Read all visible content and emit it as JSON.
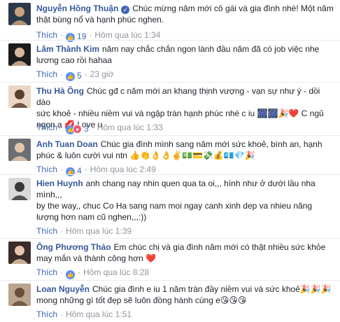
{
  "comments": [
    {
      "author": "Nguyễn Hồng Thuận",
      "verified": true,
      "text_lines": [
        "Chúc mừng năm mới cô gái và gia đình nhé! Một năm",
        "thật bùng nổ và hạnh phúc nghen."
      ],
      "like_label": "Thích",
      "reactions": [
        "like"
      ],
      "reaction_count": "19",
      "time": "Hôm qua lúc 1:34",
      "avatar_colors": [
        "#2b3a4a",
        "#c9a27e"
      ]
    },
    {
      "author": "Lâm Thành Kim",
      "verified": false,
      "text_lines": [
        "năm nay chắc chắn ngon lành đầu năm đã có job việc nhẹ",
        "lương cao rồi hahaa"
      ],
      "like_label": "Thích",
      "reactions": [
        "like"
      ],
      "reaction_count": "5",
      "time": "23 giờ",
      "avatar_colors": [
        "#1c1c1c",
        "#d8b79a"
      ]
    },
    {
      "author": "Thu Hà Ông",
      "verified": false,
      "text_lines": [
        "Chúc gđ c năm mới an khang thịnh vượng - vạn sự như ý - dồi dào",
        "sức khoẻ - nhiều niềm vui và ngập tràn hạnh phúc nhé c iu 🎆🎆🎉❤️ C ngủ",
        "ngon ạ 💋 Love u"
      ],
      "like_label": "Thích",
      "reactions": [
        "like",
        "love"
      ],
      "reaction_count": "3",
      "time": "Hôm qua lúc 1:33",
      "avatar_colors": [
        "#e9d6c4",
        "#5a3e2b"
      ]
    },
    {
      "author": "Anh Tuan Doan",
      "verified": false,
      "text_lines": [
        "Chúc gia đình mình sang năm mới sức khoẻ, bình an, hạnh",
        "phúc & luôn cười vui ntn 👍👏👌👌✌️💵💳💸💰💶💎🎉"
      ],
      "like_label": "Thích",
      "reactions": [
        "like"
      ],
      "reaction_count": "4",
      "time": "Hôm qua lúc 2:49",
      "avatar_colors": [
        "#6b6f73",
        "#e3c7aa"
      ]
    },
    {
      "author": "Hien Huynh",
      "verified": false,
      "text_lines": [
        "anh chang nay nhin quen qua ta oi,,, hình như ở dưới lầu nha",
        "mình,,,",
        "by the way,, chuc Co Ha sang nam moi ngay canh xinh dep va nhieu năng",
        "lượng hơn nam cũ nghen,,,:))"
      ],
      "like_label": "Thích",
      "reactions": [],
      "reaction_count": "",
      "time": "Hôm qua lúc 1:39",
      "avatar_colors": [
        "#d9d9d9",
        "#3a3a3a"
      ]
    },
    {
      "author": "Ông Phương Thảo",
      "verified": false,
      "text_lines": [
        "Em chúc chị và gia đình năm mới có thật nhiều sức khỏe",
        "may mắn và thành công hơn ❤️"
      ],
      "like_label": "Thích",
      "reactions": [
        "like"
      ],
      "reaction_count": "",
      "time": "Hôm qua lúc 8:28",
      "avatar_colors": [
        "#3b2c2a",
        "#e5c4aa"
      ]
    },
    {
      "author": "Loan Nguyễn",
      "verified": false,
      "text_lines": [
        "Chúc gia đình e iu 1 năm tràn đầy niềm vui và sức khoẻ🎉🎉🎉",
        "mong những gì tốt đẹp sẽ luôn đồng hành cùng e😘😘😘"
      ],
      "like_label": "Thích",
      "reactions": [],
      "reaction_count": "",
      "time": "Hôm qua lúc 1:51",
      "avatar_colors": [
        "#b9a48f",
        "#6a4f3a"
      ]
    }
  ]
}
